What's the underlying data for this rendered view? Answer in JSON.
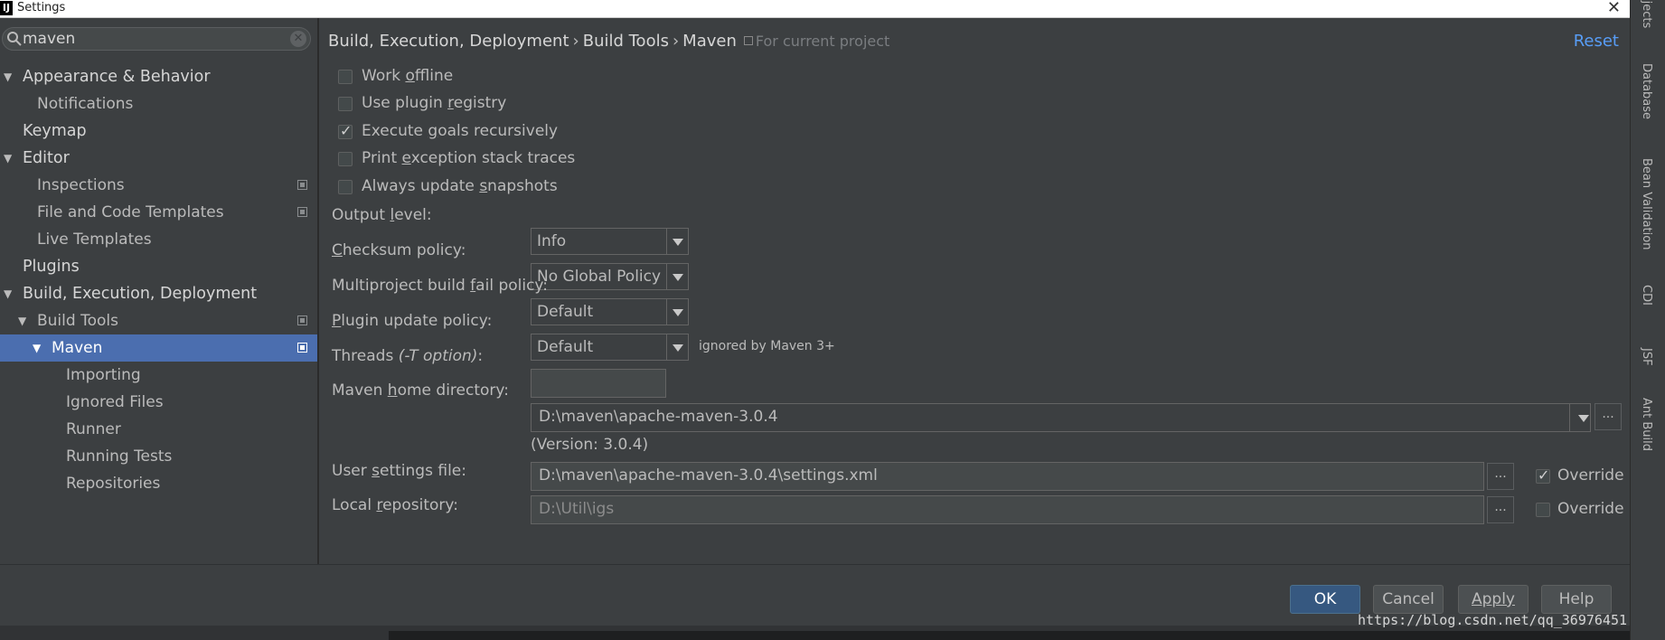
{
  "window": {
    "title": "Settings",
    "app_icon": "IJ",
    "close_glyph": "✕"
  },
  "search": {
    "value": "maven"
  },
  "tree": [
    {
      "label": "Appearance & Behavior"
    },
    {
      "label": "Notifications"
    },
    {
      "label": "Keymap"
    },
    {
      "label": "Editor"
    },
    {
      "label": "Inspections"
    },
    {
      "label": "File and Code Templates"
    },
    {
      "label": "Live Templates"
    },
    {
      "label": "Plugins"
    },
    {
      "label": "Build, Execution, Deployment"
    },
    {
      "label": "Build Tools"
    },
    {
      "label": "Maven",
      "selected": true
    },
    {
      "label": "Importing"
    },
    {
      "label": "Ignored Files"
    },
    {
      "label": "Runner"
    },
    {
      "label": "Running Tests"
    },
    {
      "label": "Repositories"
    }
  ],
  "breadcrumb": {
    "part1": "Build, Execution, Deployment",
    "part2": "Build Tools",
    "part3": "Maven",
    "sep": "›",
    "scope": "For current project"
  },
  "reset_label": "Reset",
  "checkboxes": {
    "work_offline": {
      "pre": "Work ",
      "u": "o",
      "post": "ffline",
      "checked": false
    },
    "use_plugin_registry": {
      "pre": "Use plugin ",
      "u": "r",
      "post": "egistry",
      "checked": false
    },
    "execute_goals": {
      "pre": "Execute ",
      "u": "g",
      "post": "oals recursively",
      "checked": true
    },
    "print_exception": {
      "pre": "Print ",
      "u": "e",
      "post": "xception stack traces",
      "checked": false
    },
    "always_update": {
      "pre": "Always update ",
      "u": "s",
      "post": "napshots",
      "checked": false
    }
  },
  "output_level": {
    "pre": "Output ",
    "u": "l",
    "post": "evel:",
    "value": "Info"
  },
  "checksum_policy": {
    "pre": "",
    "u": "C",
    "post": "hecksum policy:",
    "value": "No Global Policy"
  },
  "multiproject_policy": {
    "pre": "Multiproject build ",
    "u": "f",
    "post": "ail policy:",
    "value": "Default"
  },
  "plugin_update_policy": {
    "pre": "",
    "u": "P",
    "post": "lugin update policy:",
    "value": "Default",
    "hint": "ignored by Maven 3+"
  },
  "threads": {
    "label": "Threads ",
    "italic": "(-T option)",
    "end": ":",
    "value": ""
  },
  "maven_home": {
    "pre": "Maven ",
    "u": "h",
    "post": "ome directory:",
    "value": "D:\\maven\\apache-maven-3.0.4",
    "version": "(Version: 3.0.4)"
  },
  "user_settings": {
    "pre": "User ",
    "u": "s",
    "post": "ettings file:",
    "value": "D:\\maven\\apache-maven-3.0.4\\settings.xml",
    "override_label": "Override",
    "override_checked": true
  },
  "local_repo": {
    "pre": "Local ",
    "u": "r",
    "post": "epository:",
    "value": "D:\\Util\\igs",
    "override_label": "Override",
    "override_checked": false
  },
  "browse_label": "...",
  "buttons": {
    "ok": "OK",
    "cancel": "Cancel",
    "apply": "Apply",
    "help": "Help"
  },
  "tool_windows": [
    "Projects",
    "Database",
    "Bean Validation",
    "CDI",
    "JSF",
    "Ant Build"
  ],
  "watermark": "https://blog.csdn.net/qq_36976451"
}
